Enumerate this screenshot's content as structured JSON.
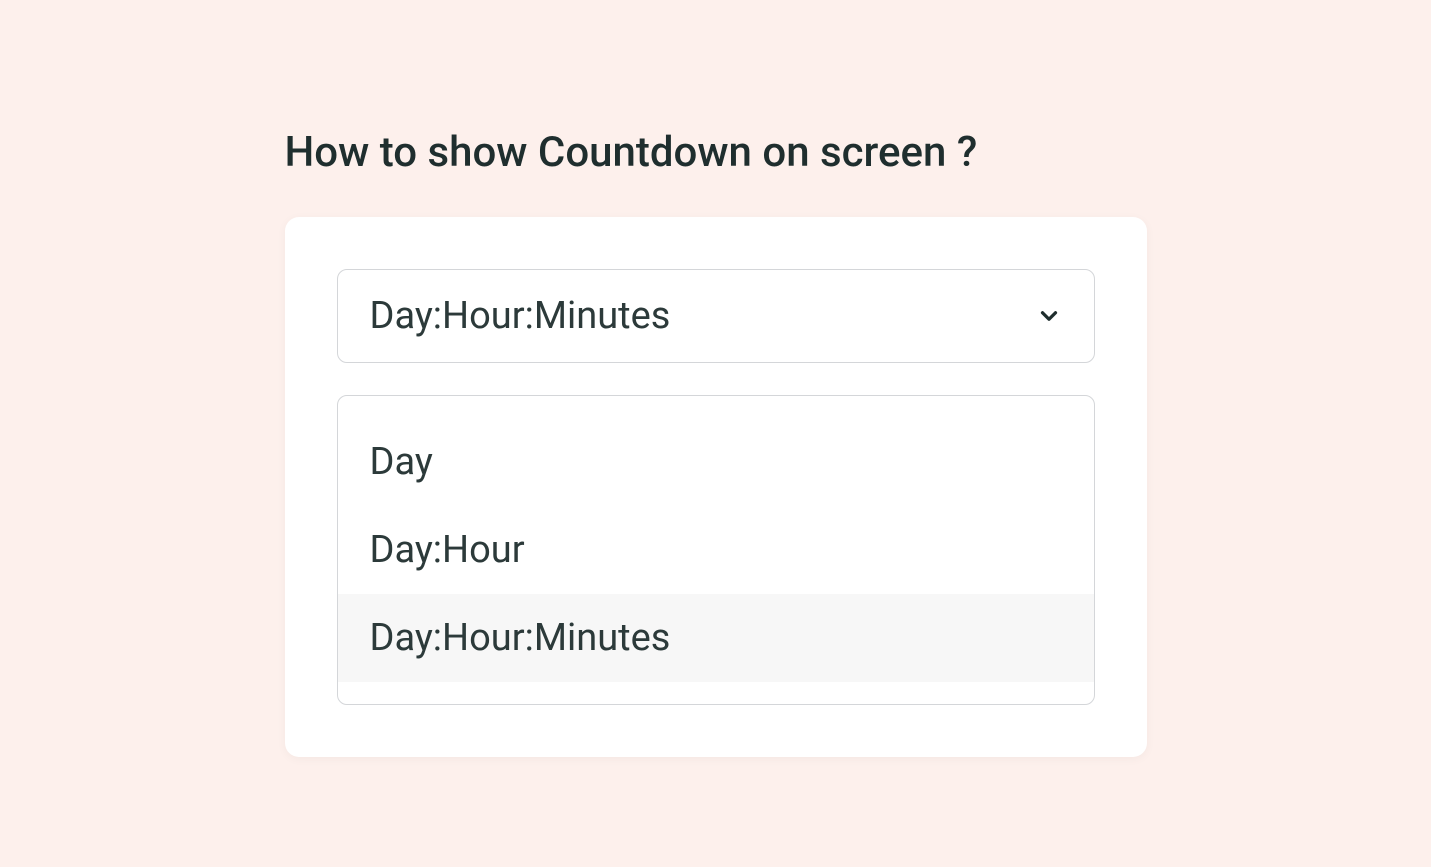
{
  "heading": "How to show Countdown on screen ?",
  "select": {
    "selected_value": "Day:Hour:Minutes",
    "options": [
      {
        "label": "Day",
        "selected": false
      },
      {
        "label": "Day:Hour",
        "selected": false
      },
      {
        "label": "Day:Hour:Minutes",
        "selected": true
      }
    ]
  }
}
